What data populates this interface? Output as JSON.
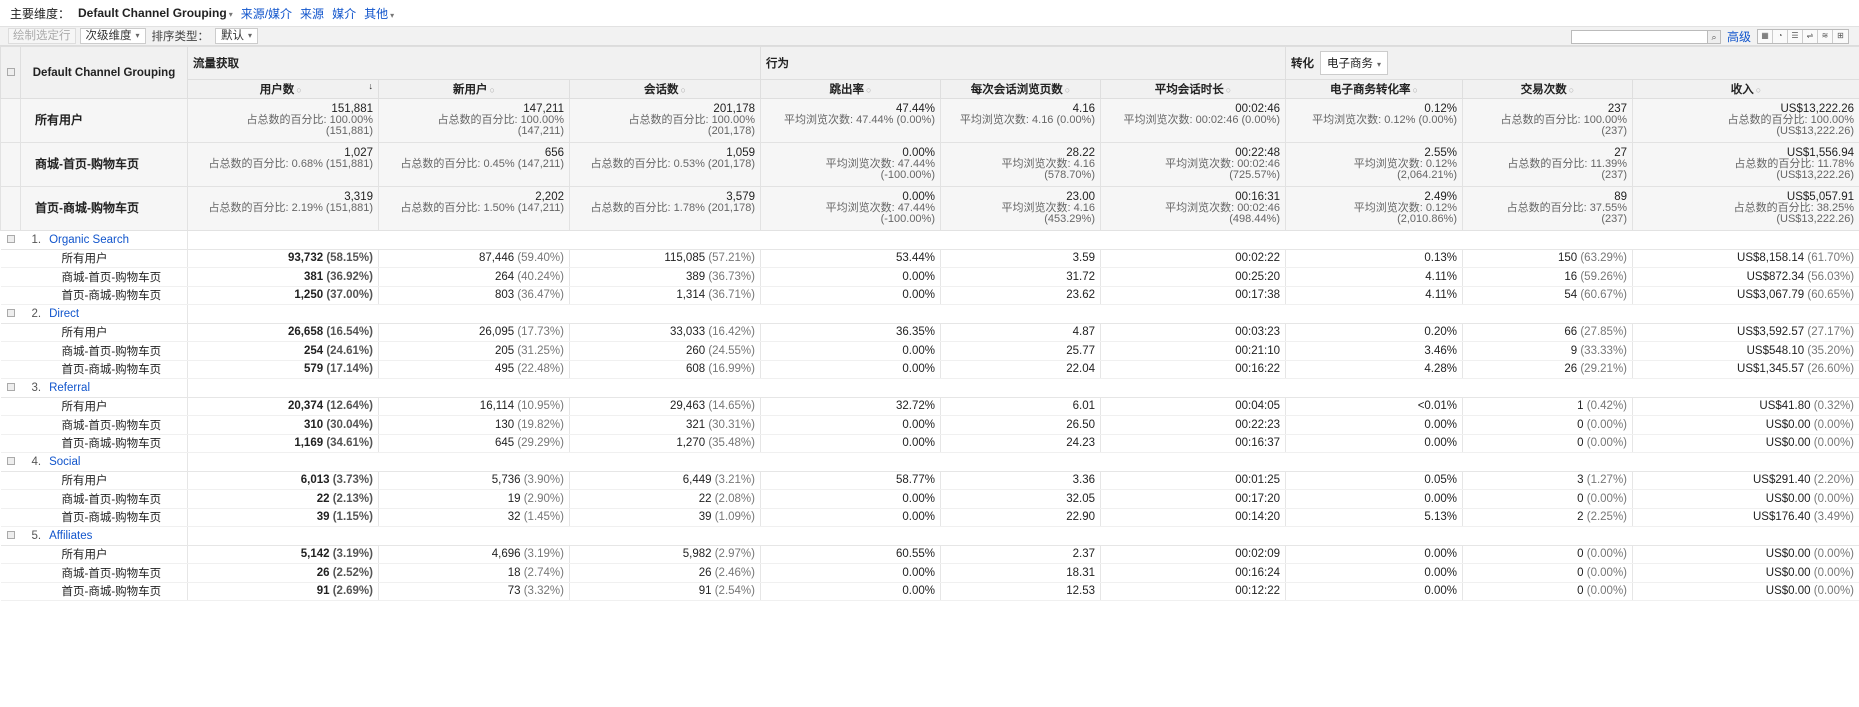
{
  "topbar": {
    "primary_label": "主要维度：",
    "primary_value": "Default Channel Grouping",
    "links": [
      "来源/媒介",
      "来源",
      "媒介",
      "其他"
    ]
  },
  "toolbar": {
    "plot_rows": "绘制选定行",
    "secondary_dim": "次级维度",
    "sort_label": "排序类型：",
    "sort_value": "默认",
    "advanced": "高级"
  },
  "header": {
    "dimension": "Default Channel Grouping",
    "group_acquisition": "流量获取",
    "group_behavior": "行为",
    "group_conversion": "转化",
    "conversion_select": "电子商务",
    "columns": [
      "用户数",
      "新用户",
      "会话数",
      "跳出率",
      "每次会话浏览页数",
      "平均会话时长",
      "电子商务转化率",
      "交易次数",
      "收入"
    ]
  },
  "summary": [
    {
      "segment": "所有用户",
      "cells": [
        [
          "151,881",
          "占总数的百分比: 100.00%",
          "(151,881)"
        ],
        [
          "147,211",
          "占总数的百分比: 100.00%",
          "(147,211)"
        ],
        [
          "201,178",
          "占总数的百分比: 100.00%",
          "(201,178)"
        ],
        [
          "47.44%",
          "平均浏览次数: 47.44% (0.00%)",
          ""
        ],
        [
          "4.16",
          "平均浏览次数: 4.16 (0.00%)",
          ""
        ],
        [
          "00:02:46",
          "平均浏览次数: 00:02:46 (0.00%)",
          ""
        ],
        [
          "0.12%",
          "平均浏览次数: 0.12% (0.00%)",
          ""
        ],
        [
          "237",
          "占总数的百分比: 100.00%",
          "(237)"
        ],
        [
          "US$13,222.26",
          "占总数的百分比: 100.00%",
          "(US$13,222.26)"
        ]
      ]
    },
    {
      "segment": "商城-首页-购物车页",
      "cells": [
        [
          "1,027",
          "占总数的百分比: 0.68% (151,881)",
          ""
        ],
        [
          "656",
          "占总数的百分比: 0.45% (147,211)",
          ""
        ],
        [
          "1,059",
          "占总数的百分比: 0.53% (201,178)",
          ""
        ],
        [
          "0.00%",
          "平均浏览次数: 47.44%",
          "(-100.00%)"
        ],
        [
          "28.22",
          "平均浏览次数: 4.16",
          "(578.70%)"
        ],
        [
          "00:22:48",
          "平均浏览次数: 00:02:46",
          "(725.57%)"
        ],
        [
          "2.55%",
          "平均浏览次数: 0.12%",
          "(2,064.21%)"
        ],
        [
          "27",
          "占总数的百分比: 11.39%",
          "(237)"
        ],
        [
          "US$1,556.94",
          "占总数的百分比: 11.78%",
          "(US$13,222.26)"
        ]
      ]
    },
    {
      "segment": "首页-商城-购物车页",
      "cells": [
        [
          "3,319",
          "占总数的百分比: 2.19% (151,881)",
          ""
        ],
        [
          "2,202",
          "占总数的百分比: 1.50% (147,211)",
          ""
        ],
        [
          "3,579",
          "占总数的百分比: 1.78% (201,178)",
          ""
        ],
        [
          "0.00%",
          "平均浏览次数: 47.44%",
          "(-100.00%)"
        ],
        [
          "23.00",
          "平均浏览次数: 4.16",
          "(453.29%)"
        ],
        [
          "00:16:31",
          "平均浏览次数: 00:02:46",
          "(498.44%)"
        ],
        [
          "2.49%",
          "平均浏览次数: 0.12%",
          "(2,010.86%)"
        ],
        [
          "89",
          "占总数的百分比: 37.55%",
          "(237)"
        ],
        [
          "US$5,057.91",
          "占总数的百分比: 38.25%",
          "(US$13,222.26)"
        ]
      ]
    }
  ],
  "groups": [
    {
      "index": "1.",
      "name": "Organic Search",
      "rows": [
        {
          "segment": "所有用户",
          "cells": [
            [
              "93,732",
              "(58.15%)"
            ],
            [
              "87,446",
              "(59.40%)"
            ],
            [
              "115,085",
              "(57.21%)"
            ],
            [
              "53.44%",
              ""
            ],
            [
              "3.59",
              ""
            ],
            [
              "00:02:22",
              ""
            ],
            [
              "0.13%",
              ""
            ],
            [
              "150",
              "(63.29%)"
            ],
            [
              "US$8,158.14",
              "(61.70%)"
            ]
          ]
        },
        {
          "segment": "商城-首页-购物车页",
          "cells": [
            [
              "381",
              "(36.92%)"
            ],
            [
              "264",
              "(40.24%)"
            ],
            [
              "389",
              "(36.73%)"
            ],
            [
              "0.00%",
              ""
            ],
            [
              "31.72",
              ""
            ],
            [
              "00:25:20",
              ""
            ],
            [
              "4.11%",
              ""
            ],
            [
              "16",
              "(59.26%)"
            ],
            [
              "US$872.34",
              "(56.03%)"
            ]
          ]
        },
        {
          "segment": "首页-商城-购物车页",
          "cells": [
            [
              "1,250",
              "(37.00%)"
            ],
            [
              "803",
              "(36.47%)"
            ],
            [
              "1,314",
              "(36.71%)"
            ],
            [
              "0.00%",
              ""
            ],
            [
              "23.62",
              ""
            ],
            [
              "00:17:38",
              ""
            ],
            [
              "4.11%",
              ""
            ],
            [
              "54",
              "(60.67%)"
            ],
            [
              "US$3,067.79",
              "(60.65%)"
            ]
          ]
        }
      ]
    },
    {
      "index": "2.",
      "name": "Direct",
      "rows": [
        {
          "segment": "所有用户",
          "cells": [
            [
              "26,658",
              "(16.54%)"
            ],
            [
              "26,095",
              "(17.73%)"
            ],
            [
              "33,033",
              "(16.42%)"
            ],
            [
              "36.35%",
              ""
            ],
            [
              "4.87",
              ""
            ],
            [
              "00:03:23",
              ""
            ],
            [
              "0.20%",
              ""
            ],
            [
              "66",
              "(27.85%)"
            ],
            [
              "US$3,592.57",
              "(27.17%)"
            ]
          ]
        },
        {
          "segment": "商城-首页-购物车页",
          "cells": [
            [
              "254",
              "(24.61%)"
            ],
            [
              "205",
              "(31.25%)"
            ],
            [
              "260",
              "(24.55%)"
            ],
            [
              "0.00%",
              ""
            ],
            [
              "25.77",
              ""
            ],
            [
              "00:21:10",
              ""
            ],
            [
              "3.46%",
              ""
            ],
            [
              "9",
              "(33.33%)"
            ],
            [
              "US$548.10",
              "(35.20%)"
            ]
          ]
        },
        {
          "segment": "首页-商城-购物车页",
          "cells": [
            [
              "579",
              "(17.14%)"
            ],
            [
              "495",
              "(22.48%)"
            ],
            [
              "608",
              "(16.99%)"
            ],
            [
              "0.00%",
              ""
            ],
            [
              "22.04",
              ""
            ],
            [
              "00:16:22",
              ""
            ],
            [
              "4.28%",
              ""
            ],
            [
              "26",
              "(29.21%)"
            ],
            [
              "US$1,345.57",
              "(26.60%)"
            ]
          ]
        }
      ]
    },
    {
      "index": "3.",
      "name": "Referral",
      "rows": [
        {
          "segment": "所有用户",
          "cells": [
            [
              "20,374",
              "(12.64%)"
            ],
            [
              "16,114",
              "(10.95%)"
            ],
            [
              "29,463",
              "(14.65%)"
            ],
            [
              "32.72%",
              ""
            ],
            [
              "6.01",
              ""
            ],
            [
              "00:04:05",
              ""
            ],
            [
              "<0.01%",
              ""
            ],
            [
              "1",
              "(0.42%)"
            ],
            [
              "US$41.80",
              "(0.32%)"
            ]
          ]
        },
        {
          "segment": "商城-首页-购物车页",
          "cells": [
            [
              "310",
              "(30.04%)"
            ],
            [
              "130",
              "(19.82%)"
            ],
            [
              "321",
              "(30.31%)"
            ],
            [
              "0.00%",
              ""
            ],
            [
              "26.50",
              ""
            ],
            [
              "00:22:23",
              ""
            ],
            [
              "0.00%",
              ""
            ],
            [
              "0",
              "(0.00%)"
            ],
            [
              "US$0.00",
              "(0.00%)"
            ]
          ]
        },
        {
          "segment": "首页-商城-购物车页",
          "cells": [
            [
              "1,169",
              "(34.61%)"
            ],
            [
              "645",
              "(29.29%)"
            ],
            [
              "1,270",
              "(35.48%)"
            ],
            [
              "0.00%",
              ""
            ],
            [
              "24.23",
              ""
            ],
            [
              "00:16:37",
              ""
            ],
            [
              "0.00%",
              ""
            ],
            [
              "0",
              "(0.00%)"
            ],
            [
              "US$0.00",
              "(0.00%)"
            ]
          ]
        }
      ]
    },
    {
      "index": "4.",
      "name": "Social",
      "rows": [
        {
          "segment": "所有用户",
          "cells": [
            [
              "6,013",
              "(3.73%)"
            ],
            [
              "5,736",
              "(3.90%)"
            ],
            [
              "6,449",
              "(3.21%)"
            ],
            [
              "58.77%",
              ""
            ],
            [
              "3.36",
              ""
            ],
            [
              "00:01:25",
              ""
            ],
            [
              "0.05%",
              ""
            ],
            [
              "3",
              "(1.27%)"
            ],
            [
              "US$291.40",
              "(2.20%)"
            ]
          ]
        },
        {
          "segment": "商城-首页-购物车页",
          "cells": [
            [
              "22",
              "(2.13%)"
            ],
            [
              "19",
              "(2.90%)"
            ],
            [
              "22",
              "(2.08%)"
            ],
            [
              "0.00%",
              ""
            ],
            [
              "32.05",
              ""
            ],
            [
              "00:17:20",
              ""
            ],
            [
              "0.00%",
              ""
            ],
            [
              "0",
              "(0.00%)"
            ],
            [
              "US$0.00",
              "(0.00%)"
            ]
          ]
        },
        {
          "segment": "首页-商城-购物车页",
          "cells": [
            [
              "39",
              "(1.15%)"
            ],
            [
              "32",
              "(1.45%)"
            ],
            [
              "39",
              "(1.09%)"
            ],
            [
              "0.00%",
              ""
            ],
            [
              "22.90",
              ""
            ],
            [
              "00:14:20",
              ""
            ],
            [
              "5.13%",
              ""
            ],
            [
              "2",
              "(2.25%)"
            ],
            [
              "US$176.40",
              "(3.49%)"
            ]
          ]
        }
      ]
    },
    {
      "index": "5.",
      "name": "Affiliates",
      "rows": [
        {
          "segment": "所有用户",
          "cells": [
            [
              "5,142",
              "(3.19%)"
            ],
            [
              "4,696",
              "(3.19%)"
            ],
            [
              "5,982",
              "(2.97%)"
            ],
            [
              "60.55%",
              ""
            ],
            [
              "2.37",
              ""
            ],
            [
              "00:02:09",
              ""
            ],
            [
              "0.00%",
              ""
            ],
            [
              "0",
              "(0.00%)"
            ],
            [
              "US$0.00",
              "(0.00%)"
            ]
          ]
        },
        {
          "segment": "商城-首页-购物车页",
          "cells": [
            [
              "26",
              "(2.52%)"
            ],
            [
              "18",
              "(2.74%)"
            ],
            [
              "26",
              "(2.46%)"
            ],
            [
              "0.00%",
              ""
            ],
            [
              "18.31",
              ""
            ],
            [
              "00:16:24",
              ""
            ],
            [
              "0.00%",
              ""
            ],
            [
              "0",
              "(0.00%)"
            ],
            [
              "US$0.00",
              "(0.00%)"
            ]
          ]
        },
        {
          "segment": "首页-商城-购物车页",
          "cells": [
            [
              "91",
              "(2.69%)"
            ],
            [
              "73",
              "(3.32%)"
            ],
            [
              "91",
              "(2.54%)"
            ],
            [
              "0.00%",
              ""
            ],
            [
              "12.53",
              ""
            ],
            [
              "00:12:22",
              ""
            ],
            [
              "0.00%",
              ""
            ],
            [
              "0",
              "(0.00%)"
            ],
            [
              "US$0.00",
              "(0.00%)"
            ]
          ]
        }
      ]
    }
  ]
}
